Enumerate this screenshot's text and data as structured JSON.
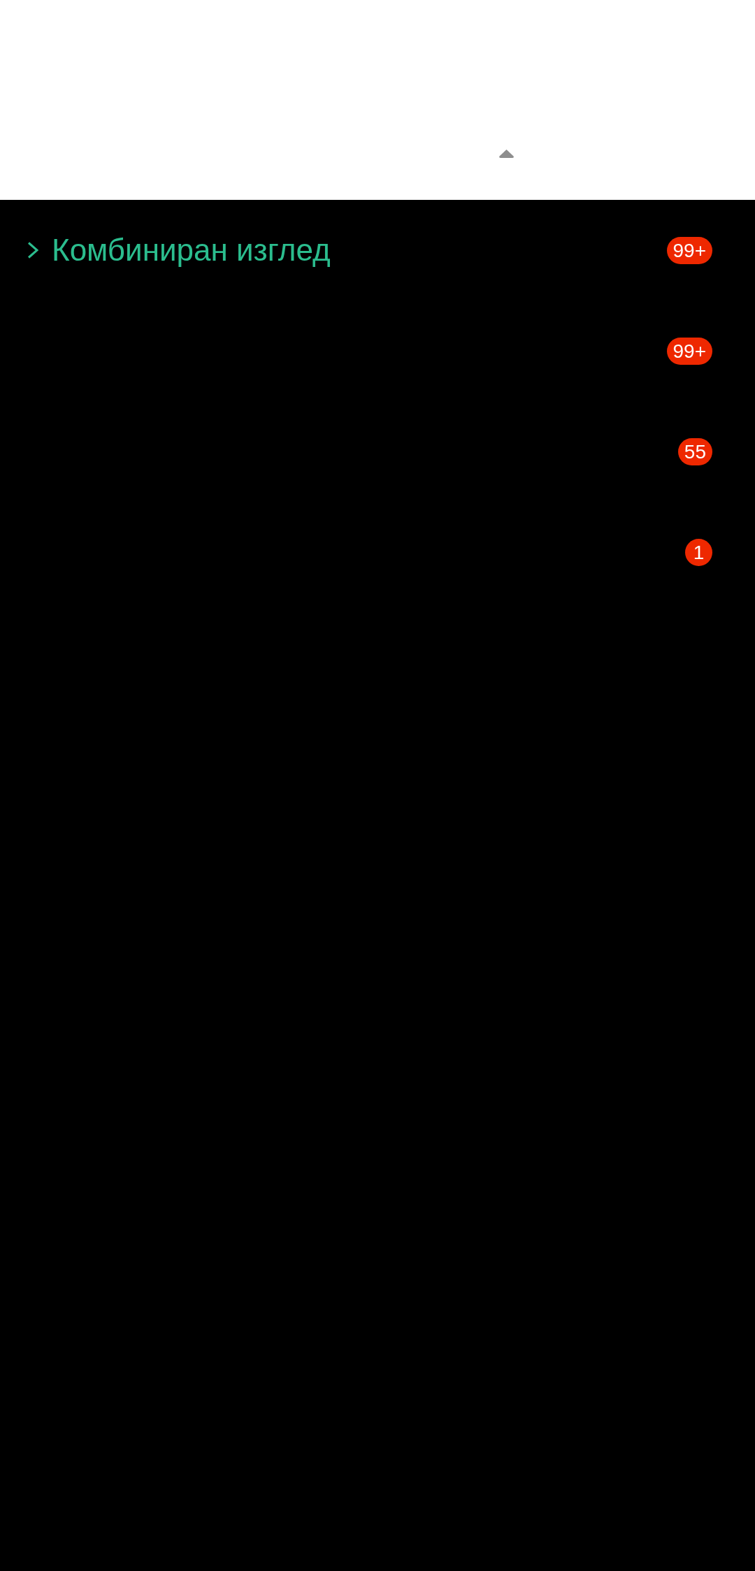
{
  "folders": [
    {
      "label": "Комбиниран изглед",
      "expanded": false,
      "count": "99+"
    },
    {
      "count": "99+"
    },
    {
      "count": "55"
    },
    {
      "count": "1"
    }
  ]
}
